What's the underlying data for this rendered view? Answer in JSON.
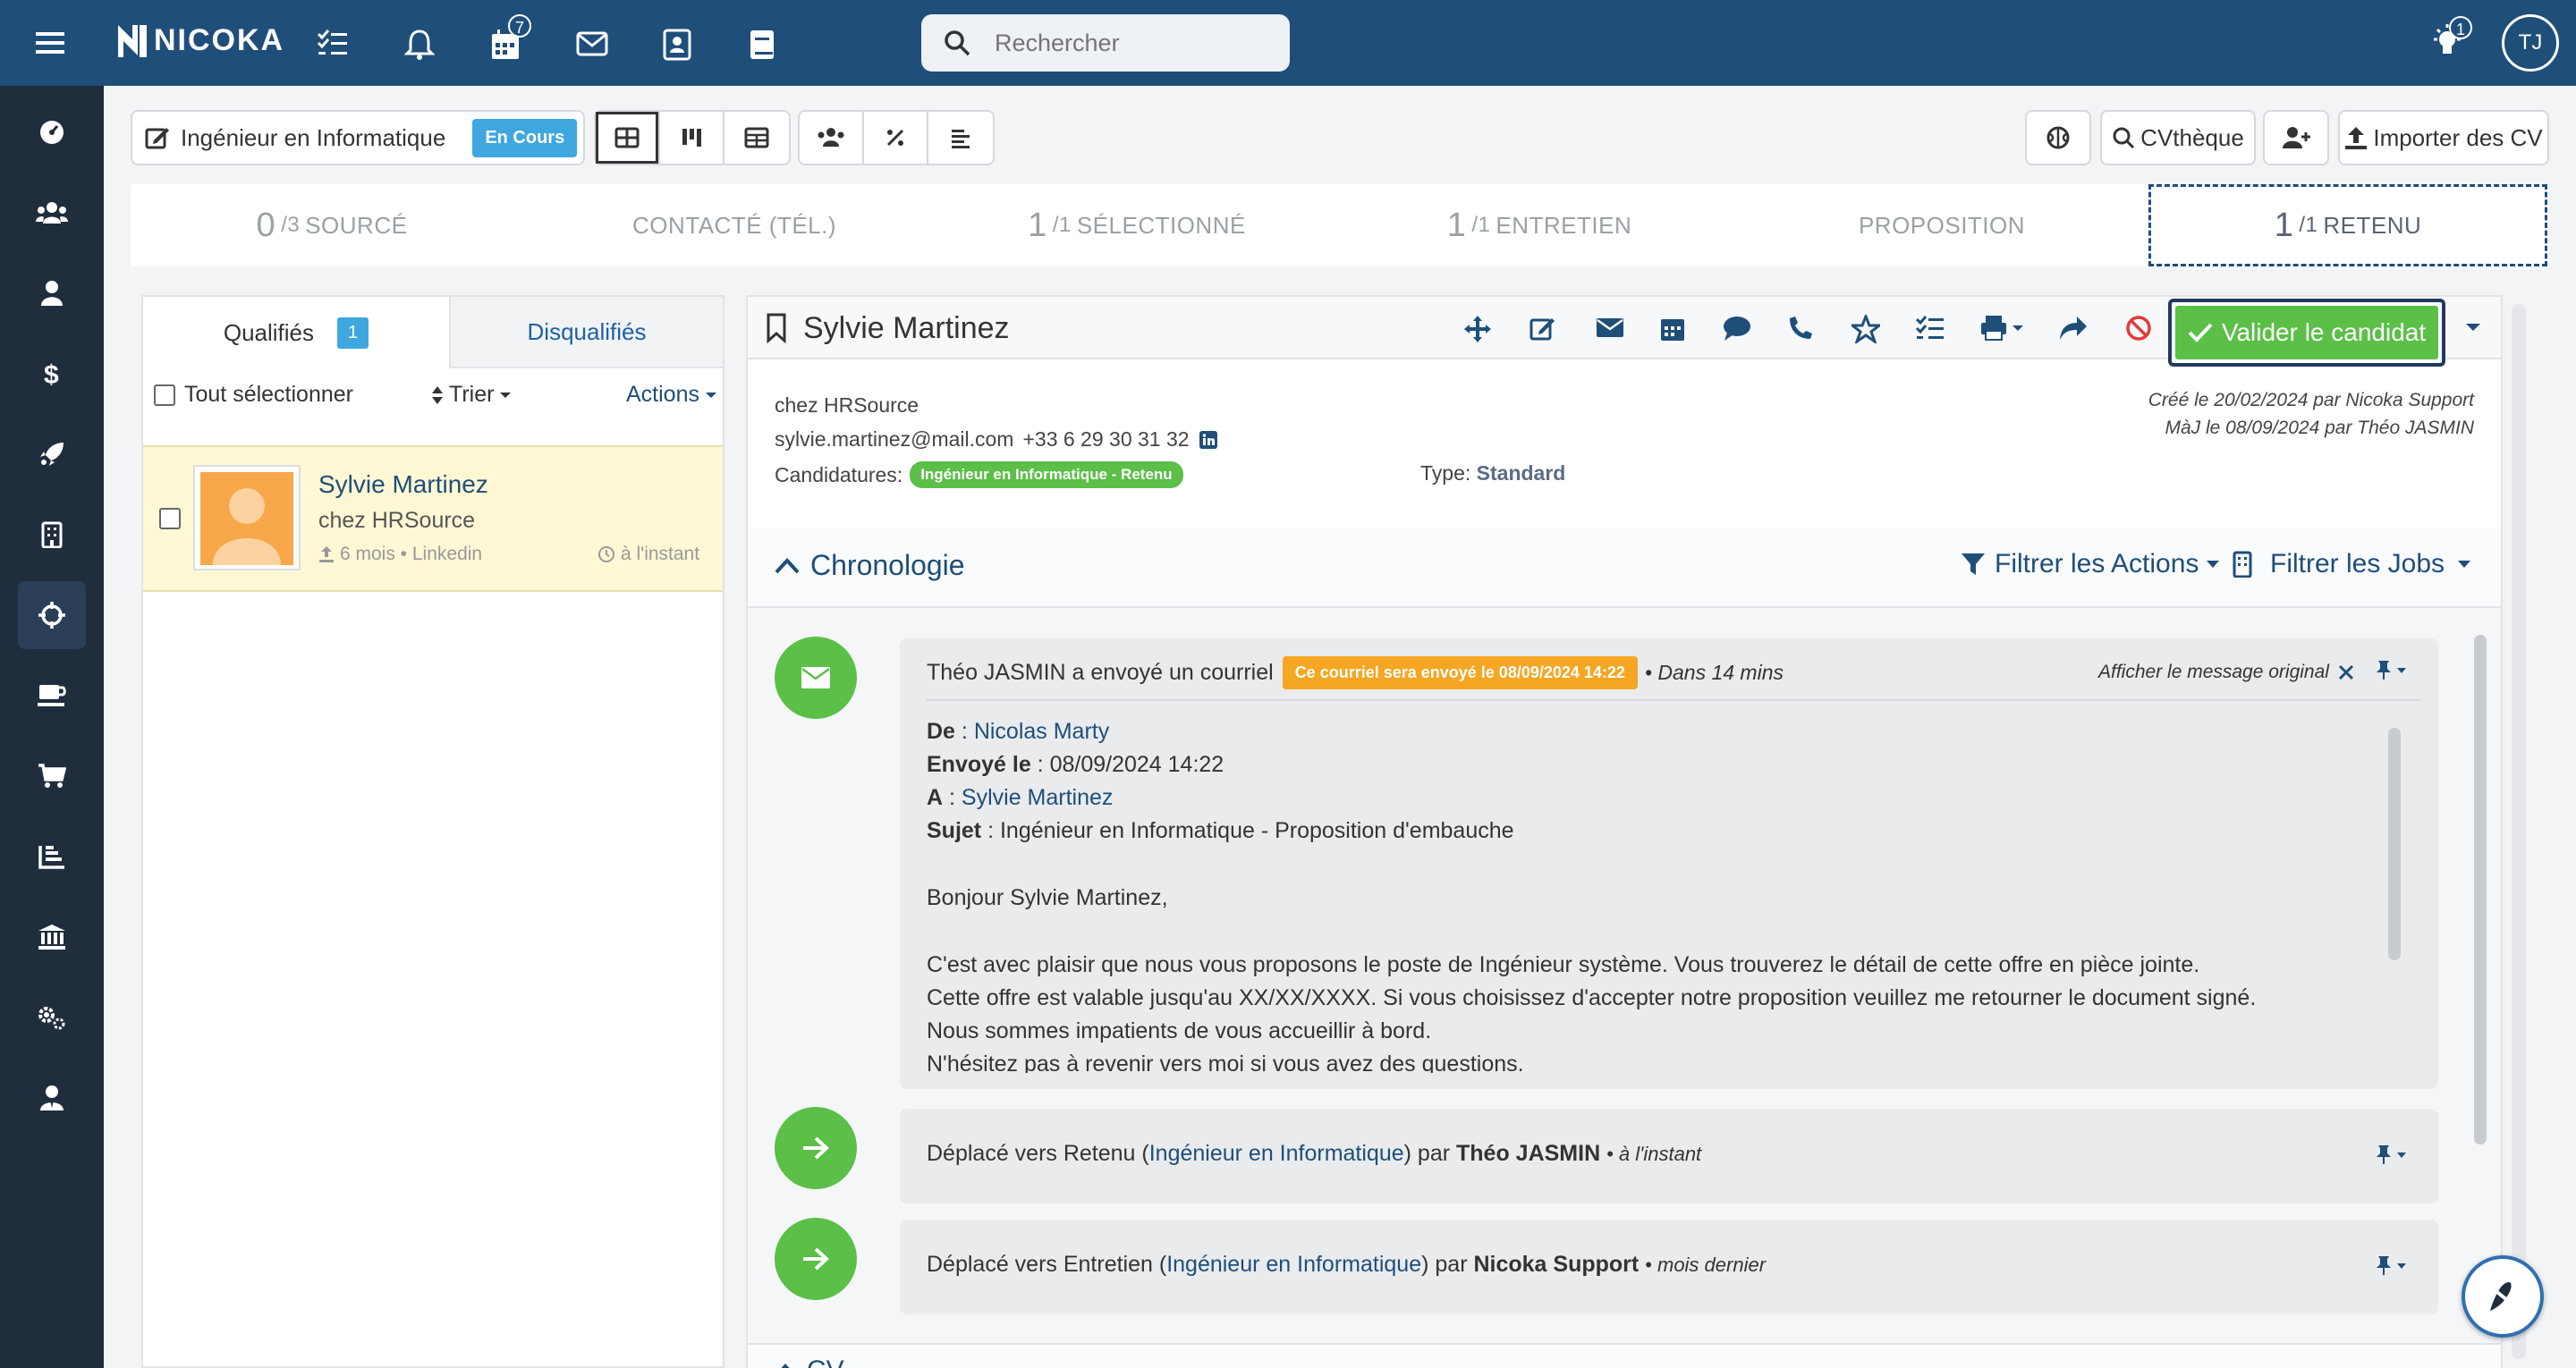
{
  "app": {
    "brand": "NICOKA",
    "calendar_badge": "7",
    "notif_badge": "1",
    "user_initials": "TJ"
  },
  "search": {
    "placeholder": "Rechercher"
  },
  "job": {
    "title": "Ingénieur en Informatique",
    "status": "En Cours"
  },
  "toolbar_right": {
    "cvtheque": "CVthèque",
    "import": "Importer des CV"
  },
  "pipeline": [
    {
      "num": "0",
      "tot": "/3",
      "label": "SOURCÉ"
    },
    {
      "num": "",
      "tot": "",
      "label": "CONTACTÉ (TÉL.)"
    },
    {
      "num": "1",
      "tot": "/1",
      "label": "SÉLECTIONNÉ"
    },
    {
      "num": "1",
      "tot": "/1",
      "label": "ENTRETIEN"
    },
    {
      "num": "",
      "tot": "",
      "label": "PROPOSITION"
    },
    {
      "num": "1",
      "tot": "/1",
      "label": "RETENU"
    }
  ],
  "list": {
    "tab_qualified": "Qualifiés",
    "qualified_count": "1",
    "tab_disqualified": "Disqualifiés",
    "select_all": "Tout sélectionner",
    "sort": "Trier",
    "actions": "Actions",
    "candidate": {
      "name": "Sylvie Martinez",
      "company": "chez HRSource",
      "meta": "6 mois • Linkedin",
      "time": "à l'instant"
    }
  },
  "detail": {
    "name": "Sylvie Martinez",
    "validate": "Valider le candidat",
    "company": "chez HRSource",
    "email": "sylvie.martinez@mail.com",
    "phone": "+33 6 29 30 31 32",
    "applications_label": "Candidatures:",
    "application_tag": "Ingénieur en Informatique - Retenu",
    "type_label": "Type:",
    "type_value": "Standard",
    "created": "Créé le 20/02/2024 par Nicoka Support",
    "updated": "MàJ le 08/09/2024 par Théo JASMIN"
  },
  "timeline": {
    "title": "Chronologie",
    "filter_actions": "Filtrer les Actions",
    "filter_jobs": "Filtrer les Jobs",
    "email_event": {
      "summary": "Théo JASMIN a envoyé un courriel",
      "scheduled": "Ce courriel sera envoyé le 08/09/2024 14:22",
      "eta": "• Dans 14 mins",
      "show_original": "Afficher le message original",
      "from_label": "De",
      "from": "Nicolas Marty",
      "sent_label": "Envoyé le",
      "sent": "08/09/2024 14:22",
      "to_label": "A",
      "to": "Sylvie Martinez",
      "subject_label": "Sujet",
      "subject": "Ingénieur en Informatique - Proposition d'embauche",
      "greeting": "Bonjour Sylvie Martinez,",
      "line1": "C'est avec plaisir que nous vous proposons le poste de Ingénieur système. Vous trouverez le détail de cette offre en pièce jointe.",
      "line2": "Cette offre est valable jusqu'au XX/XX/XXXX. Si vous choisissez d'accepter notre proposition veuillez me retourner le document signé.",
      "line3": "Nous sommes impatients de vous accueillir à bord.",
      "line4": "N'hésitez pas à revenir vers moi si vous avez des questions."
    },
    "move1": {
      "prefix": "Déplacé vers Retenu (",
      "job": "Ingénieur en Informatique",
      "mid": ") par ",
      "by": "Théo JASMIN",
      "when": "• à l'instant"
    },
    "move2": {
      "prefix": "Déplacé vers Entretien (",
      "job": "Ingénieur en Informatique",
      "mid": ") par ",
      "by": "Nicoka Support",
      "when": "• mois dernier"
    },
    "next_section": "CV"
  },
  "colors": {
    "topbar": "#1f4e79",
    "sidebar": "#1f2d3d",
    "green": "#5bbf48",
    "badge_blue": "#3fa7e0",
    "orange": "#f5a623"
  }
}
